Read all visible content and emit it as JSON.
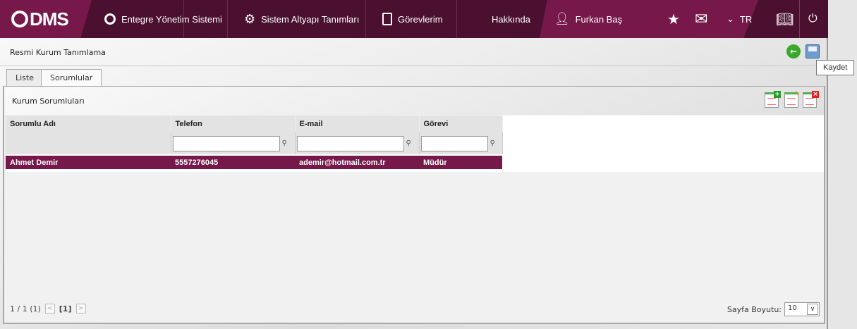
{
  "nav": {
    "logo": "DMS",
    "items": [
      "Entegre Yönetim Sistemi",
      "Sistem Altyapı Tanımları",
      "Görevlerim",
      "Hakkında"
    ],
    "user": "Furkan Baş",
    "language": "TR"
  },
  "page": {
    "title": "Resmi Kurum Tanımlama",
    "tooltip": "Kaydet"
  },
  "tabs": [
    "Liste",
    "Sorumlular"
  ],
  "panel": {
    "title": "Kurum Sorumluları",
    "columns": [
      "Sorumlu Adı",
      "Telefon",
      "E-mail",
      "Görevi"
    ],
    "rows": [
      [
        "Ahmet Demir",
        "5557276045",
        "ademir@hotmail.com.tr",
        "Müdür"
      ]
    ]
  },
  "pager": {
    "info": "1 / 1 (1)",
    "current": "[1]",
    "prev": "<",
    "next": ">",
    "page_size_label": "Sayfa Boyutu:",
    "page_size": "10"
  },
  "colors": {
    "nav": "#4b1030",
    "accent": "#761849"
  }
}
